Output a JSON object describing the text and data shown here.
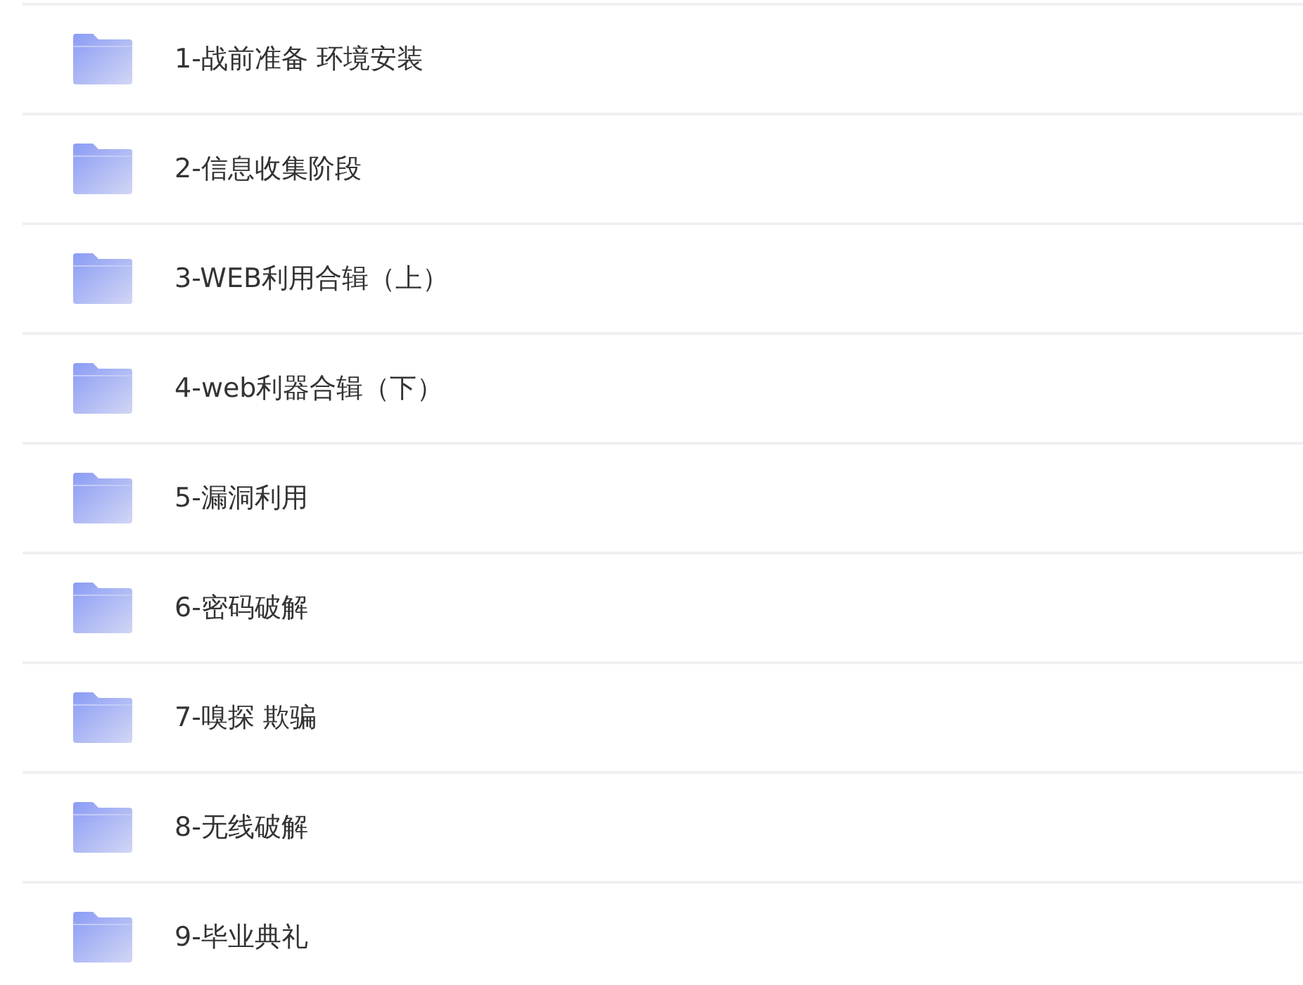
{
  "folders": [
    {
      "name": "1-战前准备 环境安装"
    },
    {
      "name": "2-信息收集阶段"
    },
    {
      "name": "3-WEB利用合辑（上）"
    },
    {
      "name": "4-web利器合辑（下）"
    },
    {
      "name": "5-漏洞利用"
    },
    {
      "name": "6-密码破解"
    },
    {
      "name": "7-嗅探 欺骗"
    },
    {
      "name": "8-无线破解"
    },
    {
      "name": "9-毕业典礼"
    }
  ]
}
